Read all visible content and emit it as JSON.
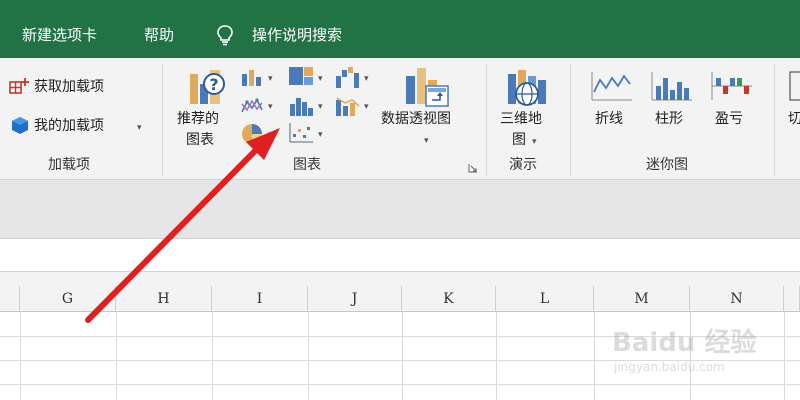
{
  "tabs": [
    "新建选项卡",
    "帮助"
  ],
  "tell_me": "操作说明搜索",
  "addins": {
    "get_addins": "获取加载项",
    "my_addins": "我的加载项",
    "group_label": "加载项"
  },
  "charts": {
    "recommended_line1": "推荐的",
    "recommended_line2": "图表",
    "pivotchart": "数据透视图",
    "group_label": "图表"
  },
  "tours": {
    "map3d_line1": "三维地",
    "map3d_line2": "图",
    "group_label": "演示"
  },
  "sparklines": {
    "line": "折线",
    "column": "柱形",
    "winloss": "盈亏",
    "group_label": "迷你图",
    "partial": "切"
  },
  "columns": [
    "G",
    "H",
    "I",
    "J",
    "K",
    "L",
    "M",
    "N"
  ],
  "watermark": {
    "brand": "Baidu 经验",
    "url": "jingyan.baidu.com"
  },
  "colors": {
    "tab_green": "#217346",
    "arrow_red": "#e02020"
  }
}
